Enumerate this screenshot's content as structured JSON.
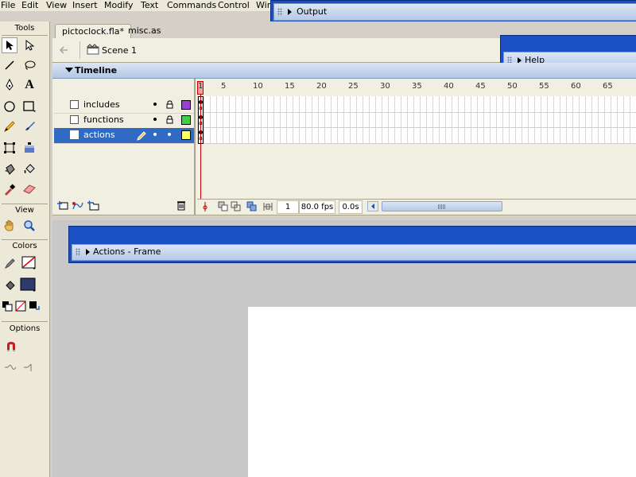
{
  "menu": [
    "File",
    "Edit",
    "View",
    "Insert",
    "Modify",
    "Text",
    "Commands",
    "Control",
    "Win"
  ],
  "panels": {
    "output": "Output",
    "help": "Help",
    "actions": "Actions - Frame"
  },
  "tools_panel": {
    "tools_label": "Tools",
    "view_label": "View",
    "colors_label": "Colors",
    "options_label": "Options"
  },
  "tabs": [
    {
      "label": "pictoclock.fla*",
      "active": true
    },
    {
      "label": "misc.as",
      "active": false
    }
  ],
  "scene": {
    "label": "Scene 1"
  },
  "timeline": {
    "title": "Timeline",
    "ruler": [
      "1",
      "5",
      "10",
      "15",
      "20",
      "25",
      "30",
      "35",
      "40",
      "45",
      "50",
      "55",
      "60",
      "65"
    ],
    "layers": [
      {
        "name": "includes",
        "color": "#9b3fd1",
        "selected": false
      },
      {
        "name": "functions",
        "color": "#3fd13f",
        "selected": false
      },
      {
        "name": "actions",
        "color": "#ffff66",
        "selected": true
      }
    ],
    "status": {
      "frame": "1",
      "fps": "80.0 fps",
      "time": "0.0s"
    }
  }
}
